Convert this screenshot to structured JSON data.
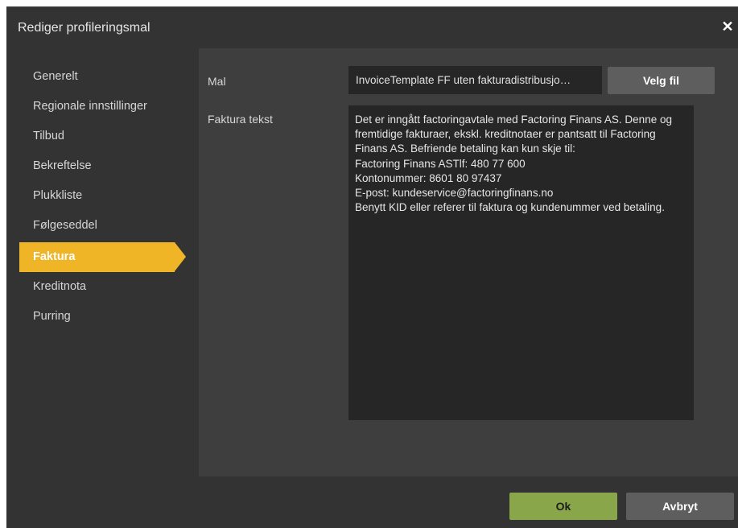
{
  "dialog": {
    "title": "Rediger profileringsmal",
    "close_glyph": "✕"
  },
  "sidebar": {
    "items": [
      {
        "label": "Generelt"
      },
      {
        "label": "Regionale innstillinger"
      },
      {
        "label": "Tilbud"
      },
      {
        "label": "Bekreftelse"
      },
      {
        "label": "Plukkliste"
      },
      {
        "label": "Følgeseddel"
      },
      {
        "label": "Faktura",
        "active": true
      },
      {
        "label": "Kreditnota"
      },
      {
        "label": "Purring"
      }
    ]
  },
  "form": {
    "template_label": "Mal",
    "template_value": "InvoiceTemplate FF uten fakturadistribusjo…",
    "choose_file_label": "Velg fil",
    "invoice_text_label": "Faktura tekst",
    "invoice_text_lines": [
      "Det er inngått factoringavtale med Factoring Finans AS. Denne og",
      "fremtidige fakturaer, ekskl. kreditnotaer er pantsatt til Factoring",
      "Finans AS. Befriende betaling kan kun skje til:",
      "Factoring Finans ASTlf: 480 77 600",
      "Kontonummer: 8601 80 97437",
      "E-post: kundeservice@factoringfinans.no",
      "Benytt KID eller referer til faktura og kundenummer ved betaling."
    ]
  },
  "footer": {
    "ok_label": "Ok",
    "cancel_label": "Avbryt"
  },
  "colors": {
    "accent": "#f0b527",
    "ok_button": "#8aa64b",
    "panel": "#3e3e3e",
    "dialog_bg": "#333333"
  }
}
